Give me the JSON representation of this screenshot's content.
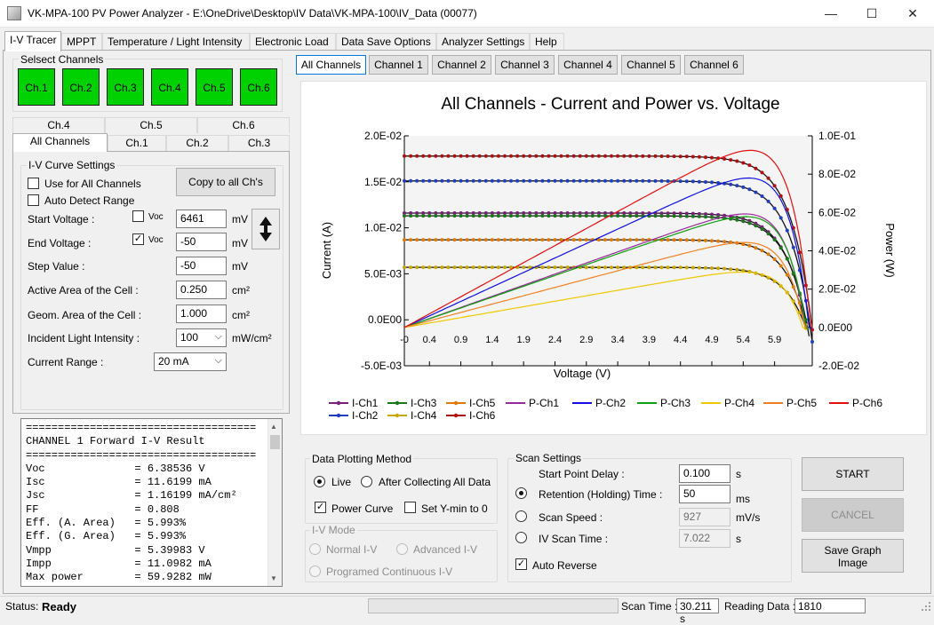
{
  "window": {
    "title": "VK-MPA-100 PV Power Analyzer - E:\\OneDrive\\Desktop\\IV Data\\VK-MPA-100\\IV_Data (00077)",
    "minimize": "—",
    "maximize": "☐",
    "close": "✕"
  },
  "menu_tabs": [
    "I-V Tracer",
    "MPPT",
    "Temperature / Light Intensity",
    "Electronic Load",
    "Data Save Options",
    "Analyzer Settings",
    "Help"
  ],
  "select_channels": {
    "title": "Selsect Channels",
    "buttons": [
      "Ch.1",
      "Ch.2",
      "Ch.3",
      "Ch.4",
      "Ch.5",
      "Ch.6"
    ],
    "color": "#00d100"
  },
  "sub_tabs": {
    "top": [
      "Ch.4",
      "Ch.5",
      "Ch.6"
    ],
    "bottom": [
      "All Channels",
      "Ch.1",
      "Ch.2",
      "Ch.3"
    ]
  },
  "iv_settings": {
    "title": "I-V Curve Settings",
    "use_all": "Use for All Channels",
    "auto_detect": "Auto Detect Range",
    "copy_button": "Copy to all Ch's",
    "start_voltage_label": "Start Voltage :",
    "start_voc": "Voc",
    "start_voltage": "6461",
    "start_unit": "mV",
    "end_voltage_label": "End Voltage :",
    "end_voc": "Voc",
    "end_voltage": "-50",
    "end_unit": "mV",
    "step_label": "Step Value :",
    "step_value": "-50",
    "step_unit": "mV",
    "active_area_label": "Active Area of the Cell :",
    "active_area": "0.250",
    "active_unit": "cm²",
    "geom_area_label": "Geom. Area of the Cell :",
    "geom_area": "1.000",
    "geom_unit": "cm²",
    "light_label": "Incident Light Intensity :",
    "light_value": "100",
    "light_unit": "mW/cm²",
    "range_label": "Current Range :",
    "range_value": "20 mA"
  },
  "result_text": "====================================\nCHANNEL 1 Forward I-V Result\n====================================\nVoc              = 6.38536 V\nIsc              = 11.6199 mA\nJsc              = 1.16199 mA/cm²\nFF               = 0.808\nEff. (A. Area)   = 5.993%\nEff. (G. Area)   = 5.993%\nVmpp             = 5.39983 V\nImpp             = 11.0982 mA\nMax power        = 59.9282 mW",
  "chart_tabs": [
    "All Channels",
    "Channel 1",
    "Channel 2",
    "Channel 3",
    "Channel 4",
    "Channel 5",
    "Channel 6"
  ],
  "chart_data": {
    "type": "line",
    "title": "All Channels - Current and Power vs. Voltage",
    "xlabel": "Voltage (V)",
    "ylabel": "Current (A)",
    "y2label": "Power (W)",
    "xlim": [
      0,
      6.5
    ],
    "ylim": [
      -0.005,
      0.02
    ],
    "y2lim": [
      -0.02,
      0.1
    ],
    "x_ticks": [
      "-0",
      "0.4",
      "0.9",
      "1.4",
      "1.9",
      "2.4",
      "2.9",
      "3.4",
      "3.9",
      "4.4",
      "4.9",
      "5.4",
      "5.9"
    ],
    "y_ticks": [
      "-5.0E-03",
      "0.0E00",
      "5.0E-03",
      "1.0E-02",
      "1.5E-02",
      "2.0E-02"
    ],
    "y2_ticks": [
      "-2.0E-02",
      "0.0E00",
      "2.0E-02",
      "4.0E-02",
      "6.0E-02",
      "8.0E-02",
      "1.0E-01"
    ],
    "grid": false,
    "legend_position": "bottom",
    "series": [
      {
        "name": "I-Ch1",
        "axis": "left",
        "color": "#7a1f7a",
        "isc": 0.0116,
        "voc": 6.39
      },
      {
        "name": "I-Ch2",
        "axis": "left",
        "color": "#1f3fbf",
        "isc": 0.0151,
        "voc": 6.45
      },
      {
        "name": "I-Ch3",
        "axis": "left",
        "color": "#1a7a1a",
        "isc": 0.0113,
        "voc": 6.4
      },
      {
        "name": "I-Ch4",
        "axis": "left",
        "color": "#c8a800",
        "isc": 0.0057,
        "voc": 6.35
      },
      {
        "name": "I-Ch5",
        "axis": "left",
        "color": "#e07b00",
        "isc": 0.0087,
        "voc": 6.38
      },
      {
        "name": "I-Ch6",
        "axis": "left",
        "color": "#b01010",
        "isc": 0.0178,
        "voc": 6.48
      },
      {
        "name": "P-Ch1",
        "axis": "right",
        "color": "#9a2a9a",
        "isc": 0.0116,
        "voc": 6.39
      },
      {
        "name": "P-Ch2",
        "axis": "right",
        "color": "#1010e0",
        "isc": 0.0151,
        "voc": 6.45
      },
      {
        "name": "P-Ch3",
        "axis": "right",
        "color": "#10a010",
        "isc": 0.0113,
        "voc": 6.4
      },
      {
        "name": "P-Ch4",
        "axis": "right",
        "color": "#f0c800",
        "isc": 0.0057,
        "voc": 6.35
      },
      {
        "name": "P-Ch5",
        "axis": "right",
        "color": "#f08020",
        "isc": 0.0087,
        "voc": 6.38
      },
      {
        "name": "P-Ch6",
        "axis": "right",
        "color": "#e01010",
        "isc": 0.0178,
        "voc": 6.48
      }
    ]
  },
  "plotting": {
    "title": "Data Plotting Method",
    "live": "Live",
    "after": "After Collecting All Data",
    "power_curve": "Power Curve",
    "ymin": "Set Y-min to 0"
  },
  "iv_mode": {
    "title": "I-V Mode",
    "normal": "Normal I-V",
    "advanced": "Advanced I-V",
    "programmed": "Programed Continuous I-V"
  },
  "scan": {
    "title": "Scan Settings",
    "start_delay_label": "Start Point Delay :",
    "start_delay": "0.100",
    "start_delay_unit": "s",
    "retention_label": "Retention (Holding) Time :",
    "retention": "50",
    "retention_unit": "ms",
    "speed_label": "Scan Speed :",
    "speed": "927",
    "speed_unit": "mV/s",
    "time_label": "IV Scan Time :",
    "time": "7.022",
    "time_unit": "s",
    "auto_reverse": "Auto Reverse"
  },
  "actions": {
    "start": "START",
    "cancel": "CANCEL",
    "save": "Save Graph Image"
  },
  "status": {
    "label": "Status:",
    "value": "Ready",
    "scan_time_label": "Scan Time :",
    "scan_time": "30.211 s",
    "reading_label": "Reading Data :",
    "reading": "1810"
  }
}
